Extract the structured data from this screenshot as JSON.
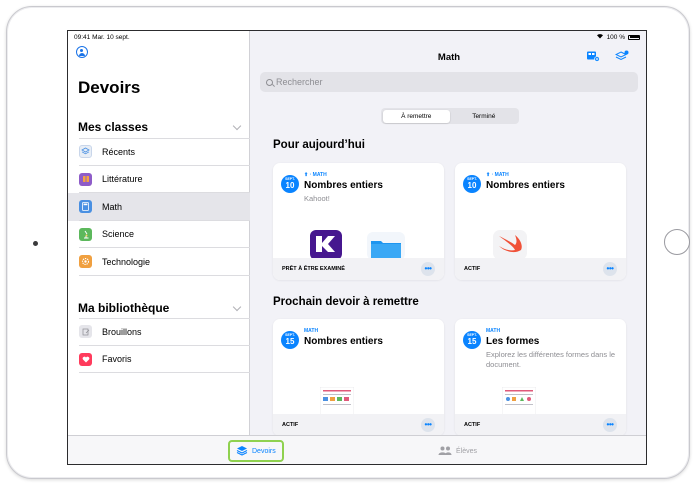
{
  "status_bar": {
    "time_date": "09:41  Mar. 10 sept.",
    "battery": "100 %"
  },
  "sidebar": {
    "title": "Devoirs",
    "classes_header": "Mes classes",
    "classes": [
      {
        "label": "Récents",
        "icon": "recents-icon",
        "color": "#e8eef6"
      },
      {
        "label": "Littérature",
        "icon": "book-icon",
        "color": "#8e5cc8"
      },
      {
        "label": "Math",
        "icon": "calculator-icon",
        "color": "#4a90e2"
      },
      {
        "label": "Science",
        "icon": "microscope-icon",
        "color": "#5cb85c"
      },
      {
        "label": "Technologie",
        "icon": "gear-icon",
        "color": "#f0a040"
      }
    ],
    "library_header": "Ma bibliothèque",
    "library": [
      {
        "label": "Brouillons",
        "icon": "draft-icon",
        "color": "#e5e5ea"
      },
      {
        "label": "Favoris",
        "icon": "heart-icon",
        "color": "#ff3b5c"
      }
    ]
  },
  "main": {
    "title": "Math",
    "search_placeholder": "Rechercher",
    "segments": [
      "À remettre",
      "Terminé"
    ],
    "today_title": "Pour aujourd’hui",
    "next_title": "Prochain devoir à remettre",
    "cards": [
      {
        "month": "SEPT.",
        "day": "10",
        "subject": "MATH",
        "title": "Nombres entiers",
        "desc": "Kahoot!",
        "status": "PRÊT À ÊTRE EXAMINÉ"
      },
      {
        "month": "SEPT.",
        "day": "10",
        "subject": "MATH",
        "title": "Nombres entiers",
        "desc": "",
        "status": "ACTIF"
      },
      {
        "month": "SEPT.",
        "day": "15",
        "subject": "MATH",
        "title": "Nombres entiers",
        "desc": "",
        "status": "ACTIF"
      },
      {
        "month": "SEPT.",
        "day": "15",
        "subject": "MATH",
        "title": "Les formes",
        "desc": "Explorez les différentes formes dans le document.",
        "status": "ACTIF"
      }
    ],
    "more_label": "•••"
  },
  "tabbar": {
    "devoirs": "Devoirs",
    "eleves": "Élèves"
  },
  "colors": {
    "accent": "#0a84ff",
    "highlight": "#8fd14f"
  }
}
